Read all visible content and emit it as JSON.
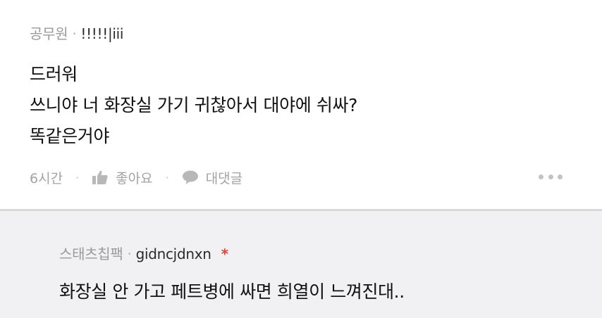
{
  "comment": {
    "author": "공무원",
    "meta_separator": "·",
    "nickname": "!!!!!|iii",
    "lines": [
      "드러워",
      "쓰니야 너 화장실 가기 귀찮아서 대야에 쉬싸?",
      "똑같은거야"
    ],
    "time": "6시간",
    "action_separator": "·",
    "like_label": "좋아요",
    "reply_label": "대댓글",
    "more_icon": "more-dots-icon",
    "like_icon": "thumbs-up-icon",
    "reply_icon": "speech-bubble-icon"
  },
  "reply": {
    "author": "스태츠칩팩",
    "meta_separator": "·",
    "nickname": "gidncjdnxn",
    "op_marker": "*",
    "text": "화장실 안 가고 페트병에 싸면 희열이 느껴진대.."
  },
  "colors": {
    "muted_text": "#9a9a9a",
    "op_marker": "#e8423c",
    "reply_background": "#f1f1f3",
    "divider": "#d9d9d9"
  }
}
